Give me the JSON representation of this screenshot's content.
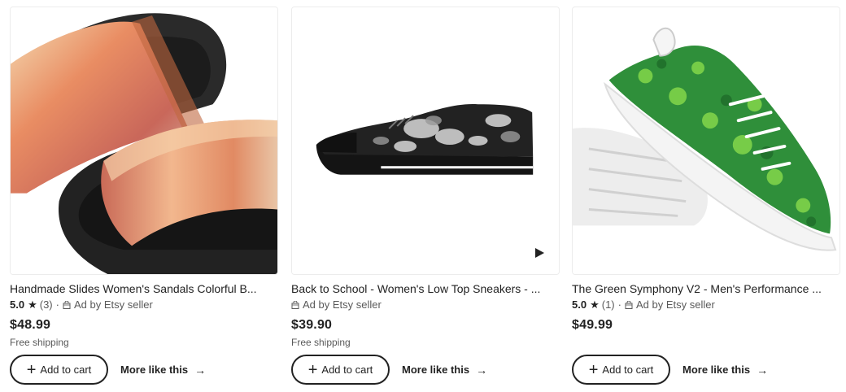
{
  "products": [
    {
      "title": "Handmade Slides Women's Sandals Colorful B...",
      "rating": "5.0",
      "reviews": "(3)",
      "ad_label": "Ad by Etsy seller",
      "price": "$48.99",
      "shipping": "Free shipping",
      "add_label": "Add to cart",
      "more_label": "More like this"
    },
    {
      "title": "Back to School - Women's Low Top Sneakers - ...",
      "ad_label": "Ad by Etsy seller",
      "price": "$39.90",
      "shipping": "Free shipping",
      "add_label": "Add to cart",
      "more_label": "More like this"
    },
    {
      "title": "The Green Symphony V2 - Men's Performance ...",
      "rating": "5.0",
      "reviews": "(1)",
      "ad_label": "Ad by Etsy seller",
      "price": "$49.99",
      "add_label": "Add to cart",
      "more_label": "More like this"
    }
  ],
  "icons": {
    "star": "star-icon",
    "ad": "shopping-bag-icon",
    "plus": "plus-icon",
    "arrow": "arrow-right-icon",
    "play": "play-icon"
  }
}
